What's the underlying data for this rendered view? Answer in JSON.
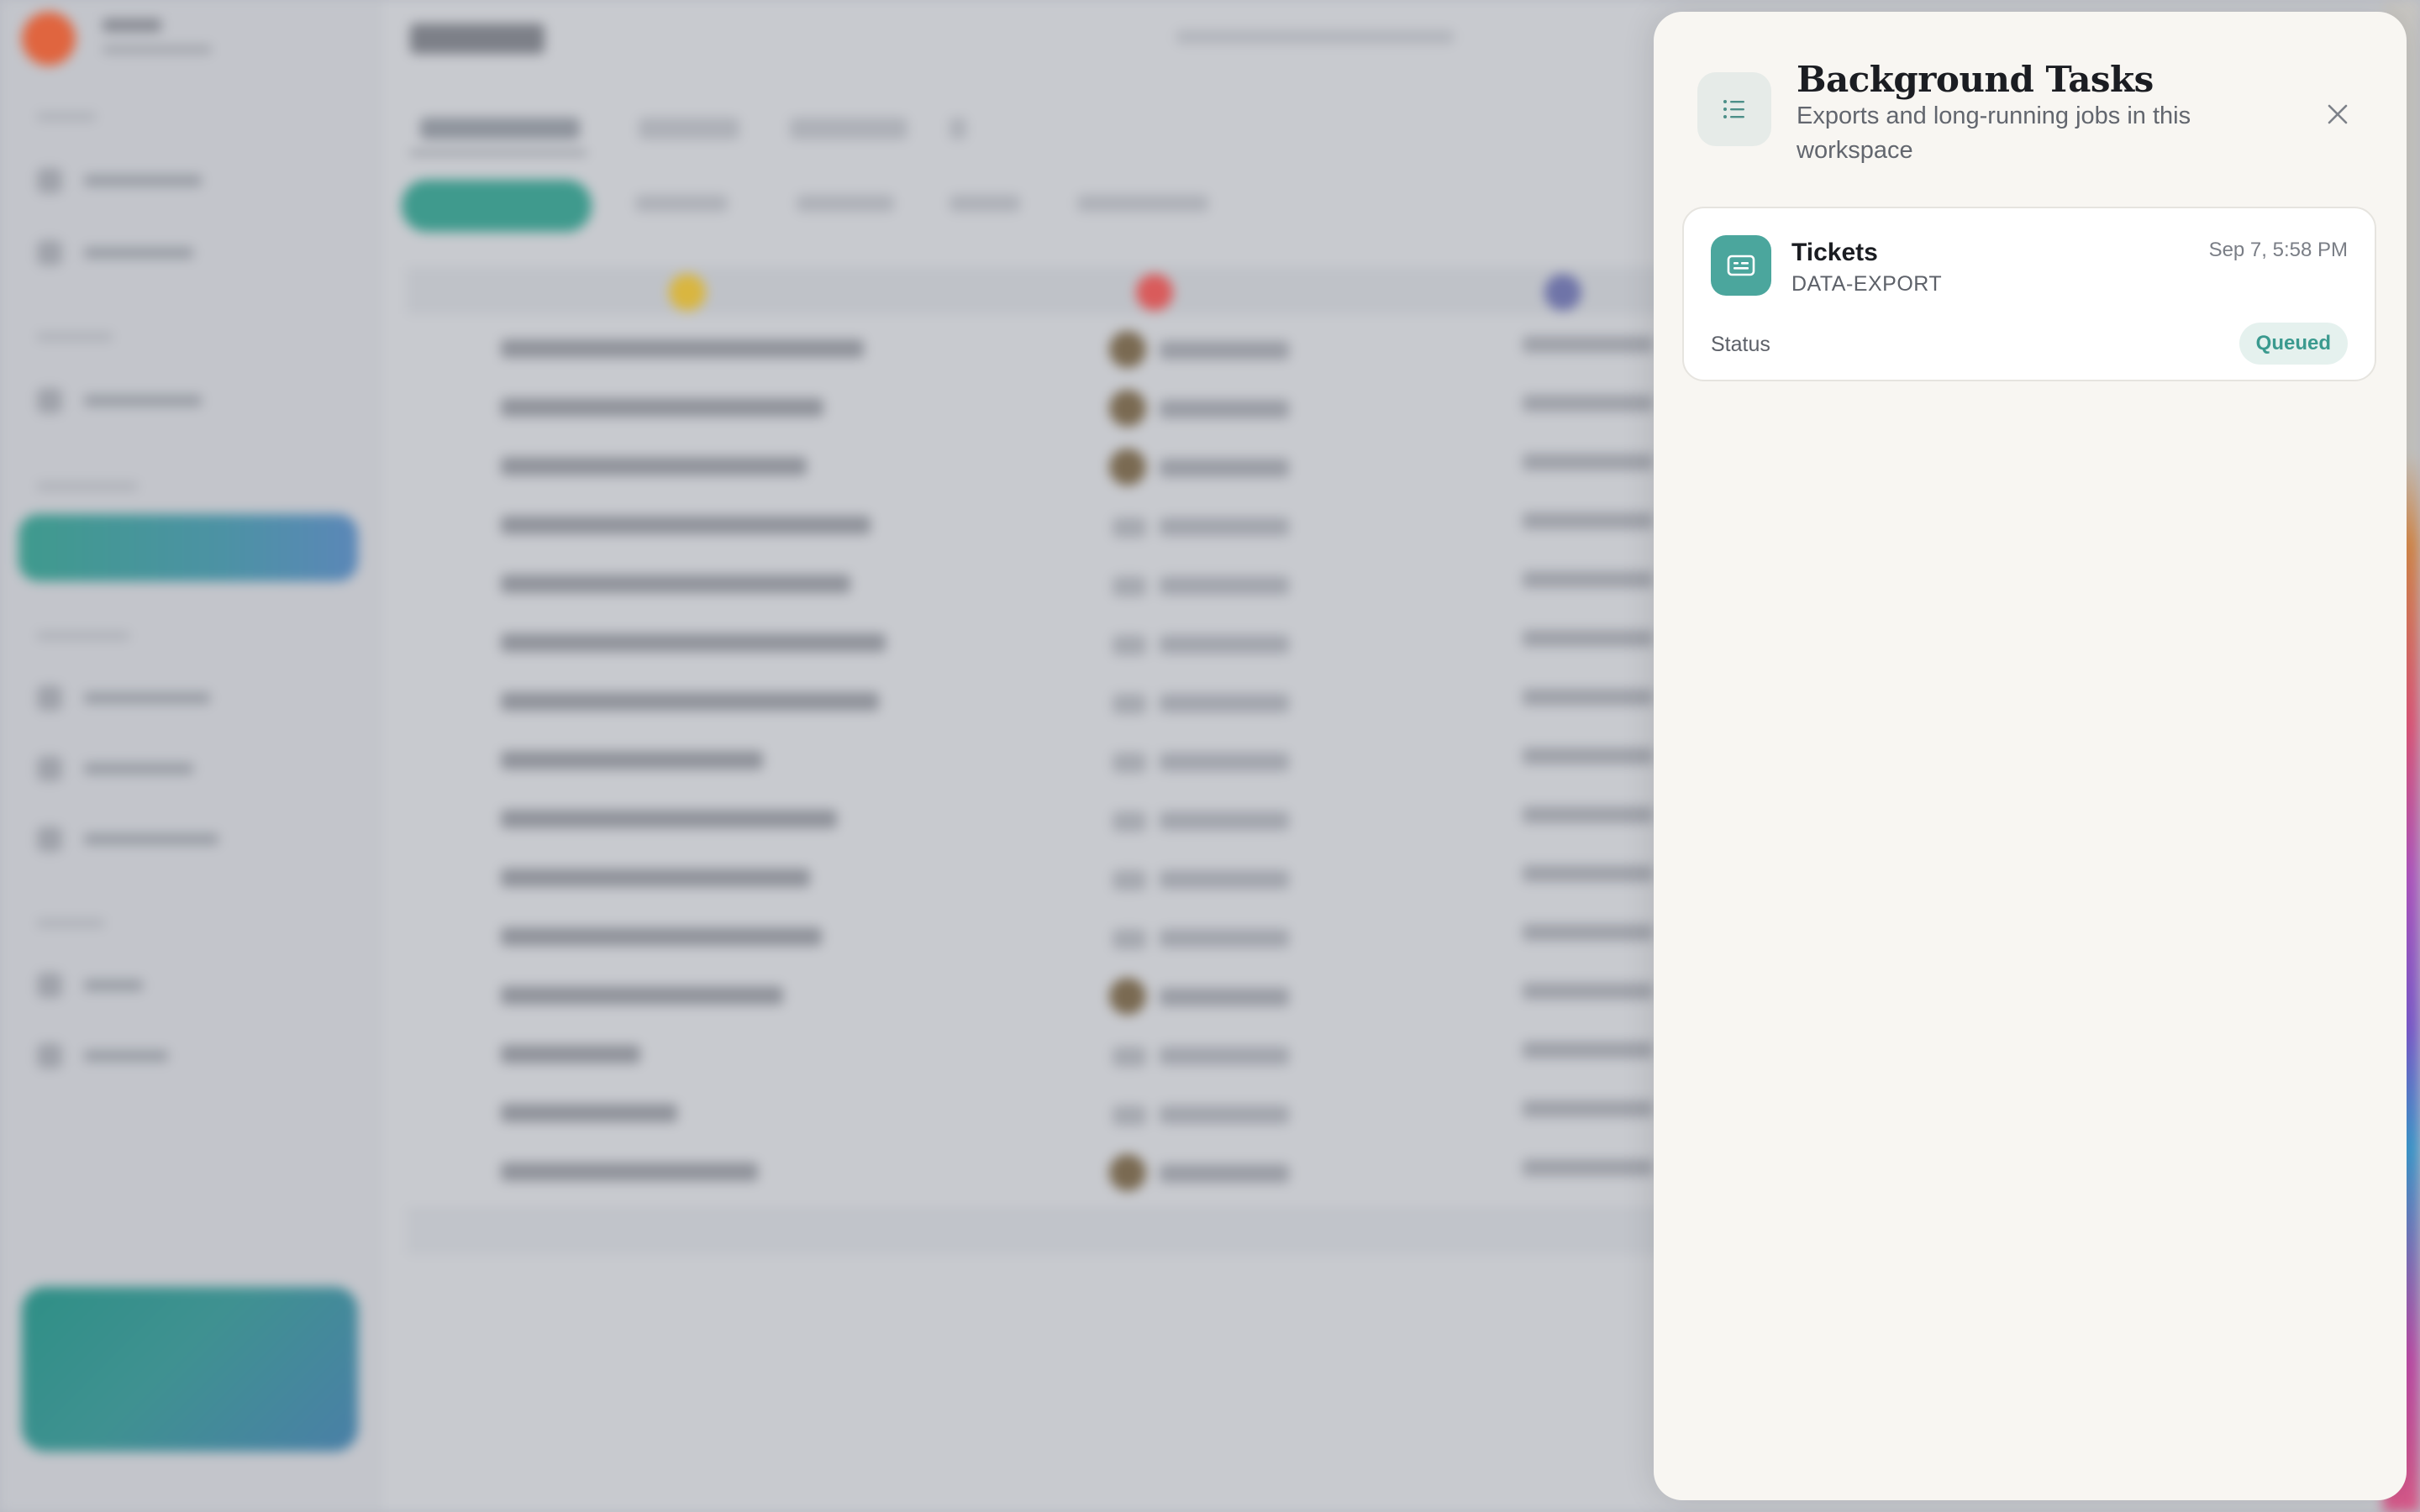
{
  "panel": {
    "title": "Background Tasks",
    "subtitle": "Exports and long-running jobs in this workspace",
    "header_icon": "list-icon",
    "close_icon": "close-icon"
  },
  "tasks": [
    {
      "name": "Tickets",
      "type": "DATA-EXPORT",
      "timestamp": "Sep 7, 5:58 PM",
      "status_label": "Status",
      "status": "Queued",
      "icon": "ticket-icon"
    }
  ],
  "colors": {
    "accent": "#4ba69d",
    "badge_bg": "#e5f1ee",
    "badge_text": "#3b9a8f",
    "panel_bg": "#f8f6f2"
  }
}
